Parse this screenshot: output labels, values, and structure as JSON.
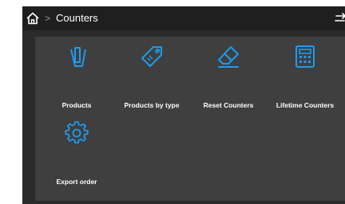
{
  "header": {
    "breadcrumb_separator": ">",
    "title": "Counters",
    "home_icon": "home-icon",
    "exit_icon": "exit-icon"
  },
  "colors": {
    "accent": "#1e9bf0",
    "screen_bg": "#2b2b2b",
    "panel_bg": "#3f3f3f",
    "topbar_bg": "#1f1f1f"
  },
  "tiles": [
    {
      "label": "Products",
      "icon": "products-icon"
    },
    {
      "label": "Products by type",
      "icon": "tags-icon"
    },
    {
      "label": "Reset Counters",
      "icon": "eraser-icon"
    },
    {
      "label": "Lifetime Counters",
      "icon": "calculator-icon"
    },
    {
      "label": "Export order",
      "icon": "gear-icon"
    }
  ]
}
